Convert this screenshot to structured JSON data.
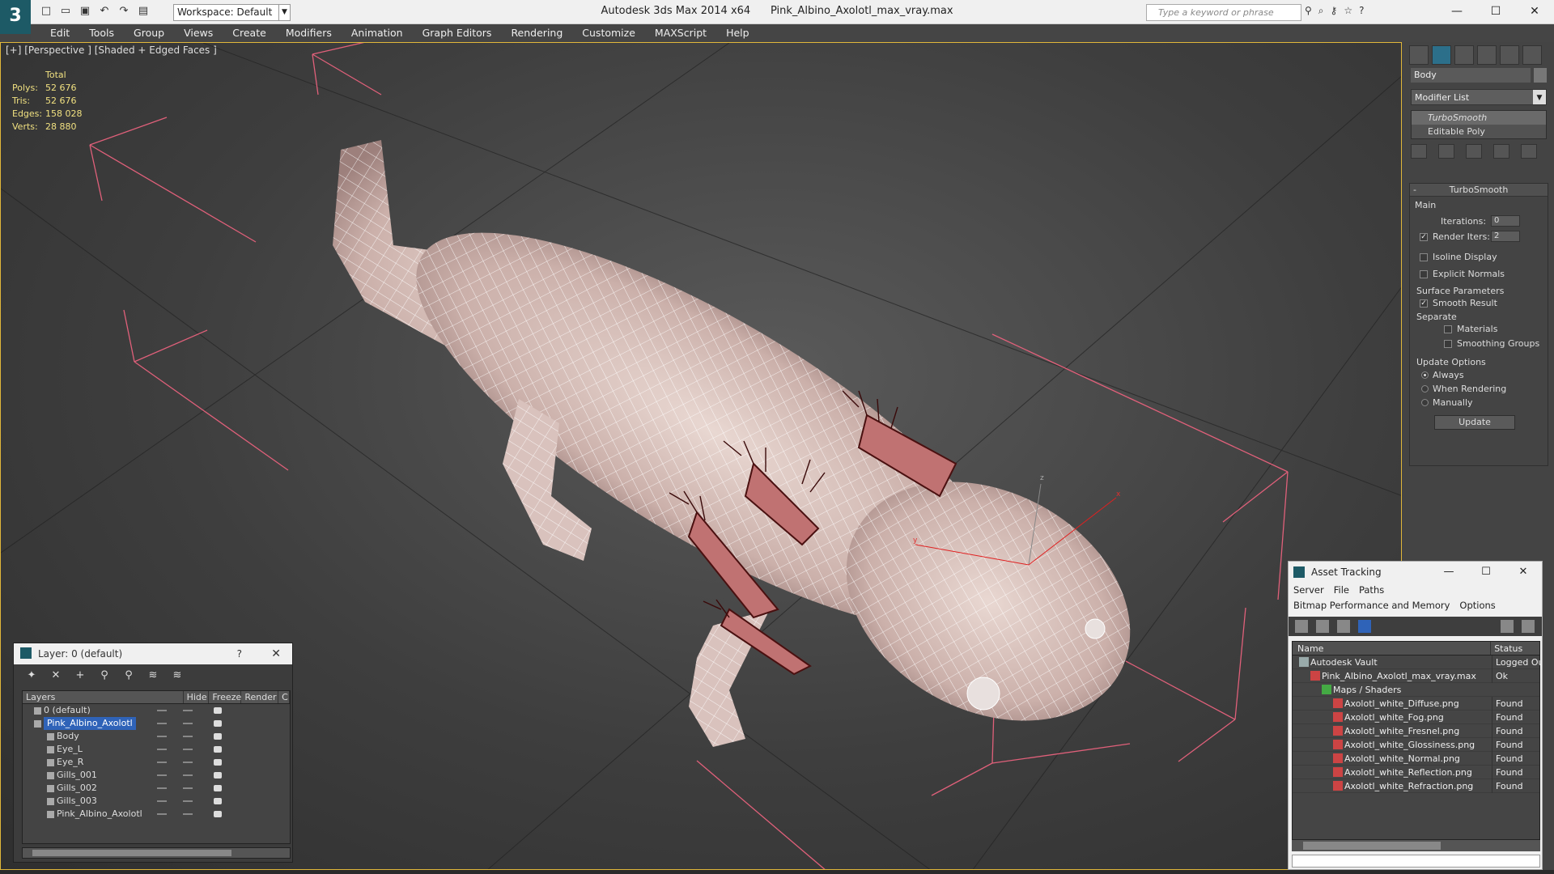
{
  "window": {
    "app_title": "Autodesk 3ds Max 2014 x64",
    "file_title": "Pink_Albino_Axolotl_max_vray.max",
    "workspace": "Workspace: Default",
    "search_placeholder": "Type a keyword or phrase"
  },
  "menu": [
    "Edit",
    "Tools",
    "Group",
    "Views",
    "Create",
    "Modifiers",
    "Animation",
    "Graph Editors",
    "Rendering",
    "Customize",
    "MAXScript",
    "Help"
  ],
  "viewport": {
    "label": "[+] [Perspective ] [Shaded + Edged Faces ]",
    "stats_header": "Total",
    "stats": [
      {
        "k": "Polys:",
        "v": "52 676"
      },
      {
        "k": "Tris:",
        "v": "52 676"
      },
      {
        "k": "Edges:",
        "v": "158 028"
      },
      {
        "k": "Verts:",
        "v": "28 880"
      }
    ],
    "axes": {
      "x": "x",
      "y": "y",
      "z": "z"
    }
  },
  "command_panel": {
    "object_name": "Body",
    "modifier_list": "Modifier List",
    "stack": [
      "TurboSmooth",
      "Editable Poly"
    ],
    "rollout_title": "TurboSmooth",
    "main_label": "Main",
    "iterations_label": "Iterations:",
    "iterations_value": "0",
    "render_iters_label": "Render Iters:",
    "render_iters_value": "2",
    "isoline": "Isoline Display",
    "explicit_normals": "Explicit Normals",
    "surface_params": "Surface Parameters",
    "smooth_result": "Smooth Result",
    "separate": "Separate",
    "materials": "Materials",
    "smoothing_groups": "Smoothing Groups",
    "update_options": "Update Options",
    "always": "Always",
    "when_rendering": "When Rendering",
    "manually": "Manually",
    "update_btn": "Update"
  },
  "layer_window": {
    "title": "Layer: 0 (default)",
    "help": "?",
    "cols": {
      "layers": "Layers",
      "hide": "Hide",
      "freeze": "Freeze",
      "render": "Render",
      "extra": "C"
    },
    "rows": [
      {
        "name": "0 (default)",
        "indent": 14,
        "selected": false
      },
      {
        "name": "Pink_Albino_Axolotl",
        "indent": 14,
        "selected": true
      },
      {
        "name": "Body",
        "indent": 30,
        "selected": false
      },
      {
        "name": "Eye_L",
        "indent": 30,
        "selected": false
      },
      {
        "name": "Eye_R",
        "indent": 30,
        "selected": false
      },
      {
        "name": "Gills_001",
        "indent": 30,
        "selected": false
      },
      {
        "name": "Gills_002",
        "indent": 30,
        "selected": false
      },
      {
        "name": "Gills_003",
        "indent": 30,
        "selected": false
      },
      {
        "name": "Pink_Albino_Axolotl",
        "indent": 30,
        "selected": false
      }
    ]
  },
  "asset_window": {
    "title": "Asset Tracking",
    "menu1": [
      "Server",
      "File",
      "Paths"
    ],
    "menu2": [
      "Bitmap Performance and Memory",
      "Options"
    ],
    "col_name": "Name",
    "col_status": "Status",
    "rows": [
      {
        "name": "Autodesk Vault",
        "status": "Logged Out",
        "indent": 22
      },
      {
        "name": "Pink_Albino_Axolotl_max_vray.max",
        "status": "Ok",
        "indent": 36
      },
      {
        "name": "Maps / Shaders",
        "status": "",
        "indent": 50
      },
      {
        "name": "Axolotl_white_Diffuse.png",
        "status": "Found",
        "indent": 64
      },
      {
        "name": "Axolotl_white_Fog.png",
        "status": "Found",
        "indent": 64
      },
      {
        "name": "Axolotl_white_Fresnel.png",
        "status": "Found",
        "indent": 64
      },
      {
        "name": "Axolotl_white_Glossiness.png",
        "status": "Found",
        "indent": 64
      },
      {
        "name": "Axolotl_white_Normal.png",
        "status": "Found",
        "indent": 64
      },
      {
        "name": "Axolotl_white_Reflection.png",
        "status": "Found",
        "indent": 64
      },
      {
        "name": "Axolotl_white_Refraction.png",
        "status": "Found",
        "indent": 64
      }
    ]
  }
}
